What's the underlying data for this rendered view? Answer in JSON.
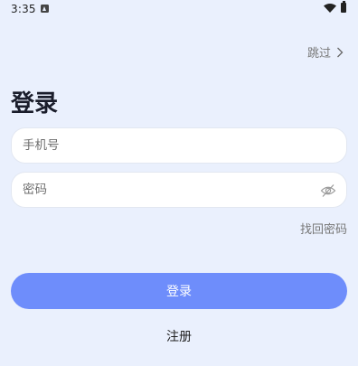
{
  "status_bar": {
    "time": "3:35",
    "icons": [
      "notification-icon",
      "wifi-icon",
      "battery-icon"
    ]
  },
  "header": {
    "skip_label": "跳过",
    "skip_icon": "chevron-right-icon"
  },
  "title": "登录",
  "form": {
    "phone_placeholder": "手机号",
    "phone_value": "",
    "password_placeholder": "密码",
    "password_value": "",
    "visibility_icon": "eye-off-icon",
    "forgot_label": "找回密码"
  },
  "actions": {
    "login_label": "登录",
    "register_label": "注册"
  },
  "colors": {
    "background": "#eaf0fd",
    "primary": "#6e8dfb",
    "field_bg": "#ffffff",
    "muted_text": "#777777"
  }
}
